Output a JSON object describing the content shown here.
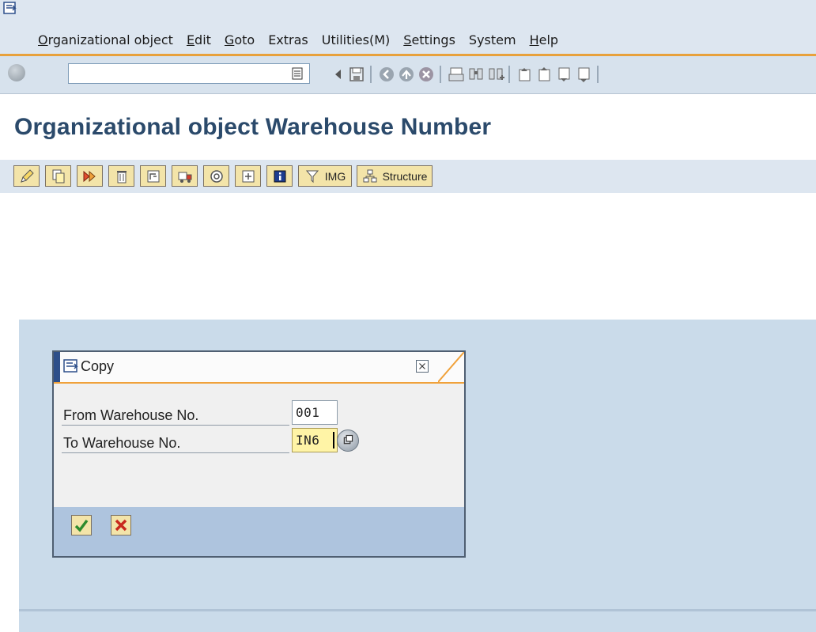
{
  "menu": {
    "items": [
      {
        "label": "Organizational object",
        "underline": "O",
        "rest": "rganizational object"
      },
      {
        "label": "Edit",
        "underline": "E",
        "rest": "dit"
      },
      {
        "label": "Goto",
        "underline": "G",
        "rest": "oto"
      },
      {
        "label": "Extras",
        "underline": "",
        "rest": "Extras"
      },
      {
        "label": "Utilities(M)",
        "underline": "",
        "rest": "Utilities(M)"
      },
      {
        "label": "Settings",
        "underline": "S",
        "rest": "ettings"
      },
      {
        "label": "System",
        "underline": "",
        "rest": "System"
      },
      {
        "label": "Help",
        "underline": "H",
        "rest": "elp"
      }
    ]
  },
  "toolbar": {
    "command_field": {
      "value": ""
    }
  },
  "title": "Organizational object Warehouse Number",
  "app_toolbar": {
    "img_label": "IMG",
    "structure_label": "Structure"
  },
  "dialog": {
    "title": "Copy",
    "fields": {
      "from_label": "From Warehouse No.",
      "from_value": "001",
      "to_label": "To Warehouse No.",
      "to_value": "IN6"
    }
  },
  "colors": {
    "menubar_bg": "#dde6f0",
    "accent_orange": "#e8a13c",
    "title_color": "#2b4a6b",
    "button_bg": "#f3e4a9",
    "content_bg": "#cadbea",
    "highlight_field": "#fff4a6"
  }
}
